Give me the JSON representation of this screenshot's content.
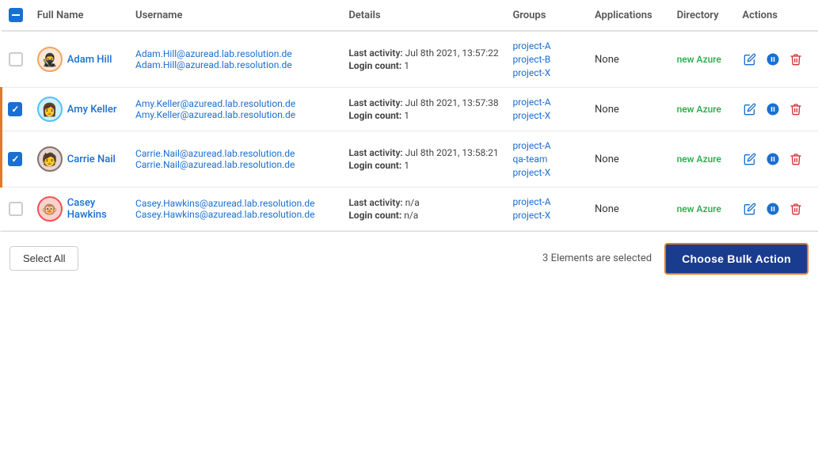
{
  "header": {
    "checkbox_state": "indeterminate",
    "col_fullname": "Full Name",
    "col_username": "Username",
    "col_details": "Details",
    "col_groups": "Groups",
    "col_applications": "Applications",
    "col_directory": "Directory",
    "col_actions": "Actions"
  },
  "users": [
    {
      "id": "adam-hill",
      "checked": false,
      "name": "Adam Hill",
      "avatar_emoji": "🥷",
      "avatar_bg": "#f4a460",
      "email_primary": "Adam.Hill@azuread.lab.resolution.de",
      "email_secondary": "Adam.Hill@azuread.lab.resolution.de",
      "last_activity": "Jul 8th 2021, 13:57:22",
      "login_count": "1",
      "groups": [
        "project-A",
        "project-B",
        "project-X"
      ],
      "applications": "None",
      "directory_label": "new Azure",
      "row_highlighted": false
    },
    {
      "id": "amy-keller",
      "checked": true,
      "name": "Amy Keller",
      "avatar_emoji": "👩",
      "avatar_bg": "#4fc3f7",
      "email_primary": "Amy.Keller@azuread.lab.resolution.de",
      "email_secondary": "Amy.Keller@azuread.lab.resolution.de",
      "last_activity": "Jul 8th 2021, 13:57:38",
      "login_count": "1",
      "groups": [
        "project-A",
        "project-X"
      ],
      "applications": "None",
      "directory_label": "new Azure",
      "row_highlighted": true
    },
    {
      "id": "carrie-nail",
      "checked": true,
      "name": "Carrie Nail",
      "avatar_emoji": "🧑",
      "avatar_bg": "#8d6e63",
      "email_primary": "Carrie.Nail@azuread.lab.resolution.de",
      "email_secondary": "Carrie.Nail@azuread.lab.resolution.de",
      "last_activity": "Jul 8th 2021, 13:58:21",
      "login_count": "1",
      "groups": [
        "project-A",
        "qa-team",
        "project-X"
      ],
      "applications": "None",
      "directory_label": "new Azure",
      "row_highlighted": true
    },
    {
      "id": "casey-hawkins",
      "checked": false,
      "name": "Casey Hawkins",
      "avatar_emoji": "🐵",
      "avatar_bg": "#ef5350",
      "email_primary": "Casey.Hawkins@azuread.lab.resolution.de",
      "email_secondary": "Casey.Hawkins@azuread.lab.resolution.de",
      "last_activity": "n/a",
      "login_count": "n/a",
      "groups": [
        "project-A",
        "project-X"
      ],
      "applications": "None",
      "directory_label": "new Azure",
      "row_highlighted": false
    }
  ],
  "footer": {
    "select_all_label": "Select All",
    "elements_selected_text": "3 Elements are selected",
    "bulk_action_label": "Choose Bulk Action"
  }
}
